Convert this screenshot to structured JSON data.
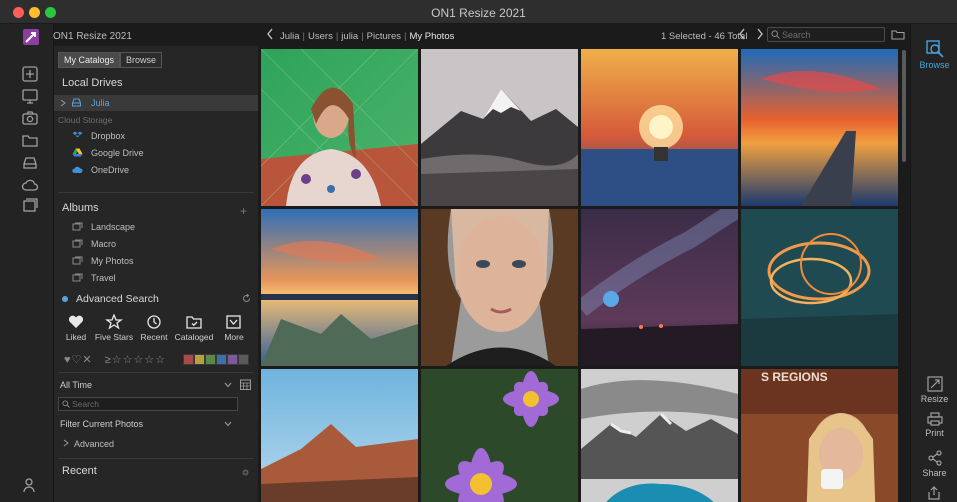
{
  "window": {
    "title": "ON1 Resize 2021"
  },
  "app": {
    "name": "ON1 Resize 2021"
  },
  "nav": {
    "breadcrumb": [
      "Julia",
      "Users",
      "julia",
      "Pictures",
      "My Photos"
    ],
    "selection_count": "1 Selected - 46 Total",
    "search_placeholder": "Search"
  },
  "sidebar": {
    "tabs": [
      "My Catalogs",
      "Browse"
    ],
    "active_tab": "My Catalogs",
    "local_drives": {
      "title": "Local Drives",
      "items": [
        "Julia"
      ]
    },
    "cloud_storage": {
      "title": "Cloud Storage",
      "items": [
        "Dropbox",
        "Google Drive",
        "OneDrive"
      ]
    },
    "albums": {
      "title": "Albums",
      "items": [
        "Landscape",
        "Macro",
        "My Photos",
        "Travel"
      ]
    },
    "advanced_search": {
      "title": "Advanced Search",
      "filters": [
        "Liked",
        "Five Stars",
        "Recent",
        "Cataloged",
        "More"
      ],
      "rating_glyphs": "♥♡✕",
      "stars": "≥☆☆☆☆☆",
      "color_labels": [
        "#a84a4a",
        "#b8a040",
        "#5a8a4a",
        "#3f6fa8",
        "#7a5a9a",
        "#5a5a5a",
        "#707070"
      ]
    },
    "time_range": "All Time",
    "search_placeholder": "Search",
    "filter_current": "Filter Current Photos",
    "advanced_label": "Advanced",
    "recent": {
      "title": "Recent"
    }
  },
  "right_rail": {
    "top": "Browse",
    "bottom": [
      "Resize",
      "Print",
      "Share"
    ]
  },
  "colors": {
    "accent": "#4aa3df",
    "selected_row": "#3a3a3a"
  }
}
